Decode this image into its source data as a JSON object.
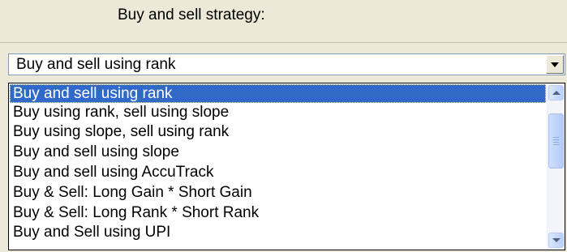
{
  "strategy_group": {
    "label": "Buy and sell strategy:"
  },
  "combo": {
    "selected_value": "Buy and sell using rank",
    "dropdown_icon": "triangle-down-icon"
  },
  "dropdown": {
    "options": [
      "Buy and sell using rank",
      "Buy using rank, sell using slope",
      "Buy using slope, sell using rank",
      "Buy and sell using slope",
      "Buy and sell using AccuTrack",
      "Buy & Sell: Long Gain * Short Gain",
      "Buy & Sell: Long Rank * Short Rank",
      "Buy and Sell using UPI"
    ],
    "highlighted_index": 0,
    "scrollbar_icons": [
      "chevron-up-icon",
      "chevron-down-icon"
    ]
  },
  "colors": {
    "window_bg": "#ece9d8",
    "selection_bg": "#316ac5",
    "selection_text": "#ffffff",
    "field_border": "#7f9db9"
  }
}
